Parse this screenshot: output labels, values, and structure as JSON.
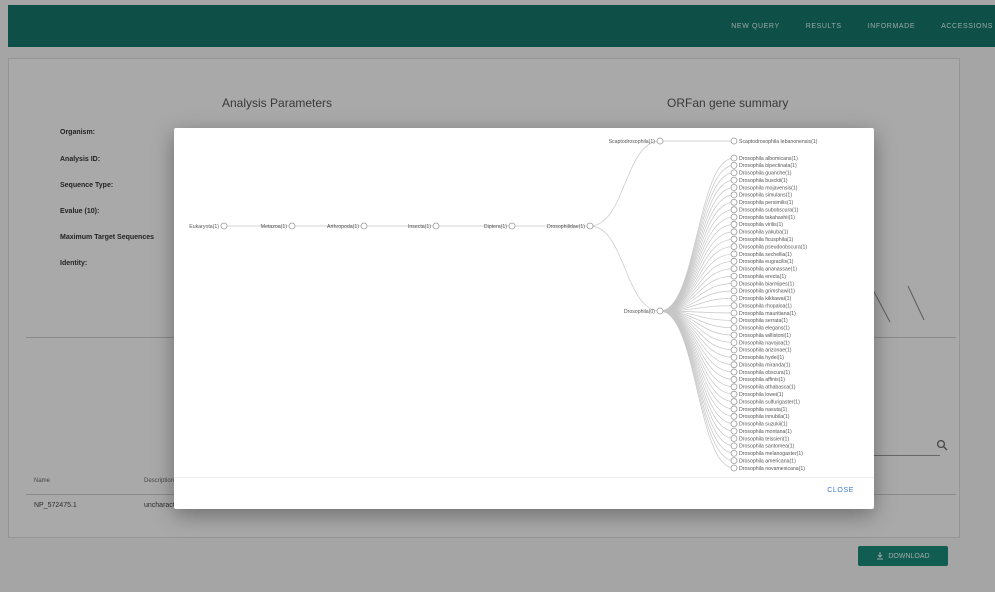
{
  "nav": {
    "items": [
      "NEW QUERY",
      "RESULTS",
      "INFORMADE",
      "ACCESSIONS"
    ]
  },
  "page": {
    "params_title": "Analysis Parameters",
    "summary_title": "ORFan gene summary",
    "param_labels": [
      "Organism:",
      "Analysis ID:",
      "Sequence Type:",
      "Evalue (10):",
      "Maximum Target Sequences",
      "Identity:"
    ]
  },
  "table": {
    "headers": [
      "Name",
      "Description"
    ],
    "row": [
      "NP_572475.1",
      "uncharacterized"
    ]
  },
  "download_label": "DOWNLOAD",
  "tree": {
    "main_chain": [
      "Eukaryota(1)",
      "Metazoa(1)",
      "Arthropoda(1)",
      "Insecta(1)",
      "Diptera(1)",
      "Drosophilidae(1)"
    ],
    "genus_upper": "Scaptodrosophila(1)",
    "species_upper": [
      "Scaptodrosophila lebanonensis(1)"
    ],
    "genus_lower": "Drosophila(0)",
    "species_lower": [
      "Drosophila albomicans(1)",
      "Drosophila bipectinata(1)",
      "Drosophila guanche(1)",
      "Drosophila busckii(1)",
      "Drosophila mojavensis(1)",
      "Drosophila simulans(1)",
      "Drosophila persimilis(1)",
      "Drosophila subobscura(1)",
      "Drosophila takahashii(1)",
      "Drosophila virilis(1)",
      "Drosophila yakuba(1)",
      "Drosophila ficusphila(1)",
      "Drosophila pseudoobscura(1)",
      "Drosophila sechellia(1)",
      "Drosophila eugracilis(1)",
      "Drosophila ananassae(1)",
      "Drosophila erecta(1)",
      "Drosophila biarmipes(1)",
      "Drosophila grimshawi(1)",
      "Drosophila kikkawai(1)",
      "Drosophila rhopaloa(1)",
      "Drosophila mauritiana(1)",
      "Drosophila serrata(1)",
      "Drosophila elegans(1)",
      "Drosophila willistoni(1)",
      "Drosophila navojoa(1)",
      "Drosophila arizonae(1)",
      "Drosophila hydei(1)",
      "Drosophila miranda(1)",
      "Drosophila obscura(1)",
      "Drosophila affinis(1)",
      "Drosophila athabasca(1)",
      "Drosophila lowei(1)",
      "Drosophila sulfurigaster(1)",
      "Drosophila nasuta(1)",
      "Drosophila innubila(1)",
      "Drosophila suzukii(1)",
      "Drosophila montana(1)",
      "Drosophila teissieri(1)",
      "Drosophila santomea(1)",
      "Drosophila melanogaster(1)",
      "Drosophila americana(1)",
      "Drosophila novamexicana(1)"
    ]
  },
  "modal": {
    "close_label": "CLOSE"
  }
}
